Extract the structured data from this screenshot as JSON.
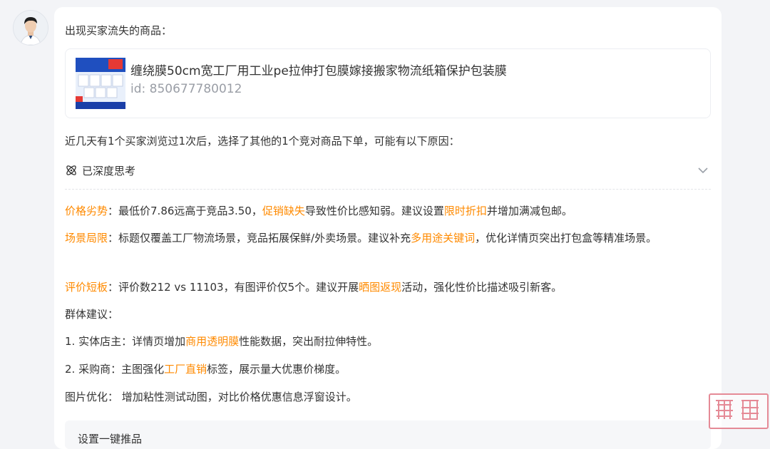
{
  "colors": {
    "accent": "#ff8a00",
    "text": "#333333",
    "muted": "#9a9ea6",
    "panel": "#ffffff",
    "background": "#f3f4f7"
  },
  "intro_text": "出现买家流失的商品：",
  "product": {
    "title": "缠绕膜50cm宽工厂用工业pe拉伸打包膜嫁接搬家物流纸箱保护包装膜",
    "id_text": "id: 850677780012"
  },
  "summary_text": "近几天有1个买家浏览过1次后，选择了其他的1个竞对商品下单，可能有以下原因：",
  "thinking": {
    "label": "已深度思考",
    "icon": "atom-icon",
    "toggle_icon": "chevron-down-icon"
  },
  "reasons": [
    {
      "title": "价格劣势",
      "p1": "：最低价7.86远高于竞品3.50，",
      "h1": "促销缺失",
      "p2": "导致性价比感知弱。建议设置",
      "h2": "限时折扣",
      "p3": "并增加满减包邮。"
    },
    {
      "title": "场景局限",
      "p1": "：标题仅覆盖工厂物流场景，竞品拓展保鲜/外卖场景。建议补充",
      "h1": "多用途关键词",
      "p2": "，优化详情页突出打包盒等精准场景。"
    },
    {
      "title": "评价短板",
      "p1": "：评价数212 vs 11103，有图评价仅5个。建议开展",
      "h1": "晒图返现",
      "p2": "活动，强化性价比描述吸引新客。"
    }
  ],
  "group_header": "群体建议：",
  "group_items": [
    {
      "p1": "1. 实体店主：详情页增加",
      "h1": "商用透明膜",
      "p2": "性能数据，突出耐拉伸特性。"
    },
    {
      "p1": "2. 采购商：主图强化",
      "h1": "工厂直销",
      "p2": "标签，展示量大优惠价梯度。"
    }
  ],
  "image_opt": "图片优化：  增加粘性测试动图，对比价格优惠信息浮窗设计。",
  "bottom_button": "设置一键推品",
  "watermark_text": "鸟瞰"
}
